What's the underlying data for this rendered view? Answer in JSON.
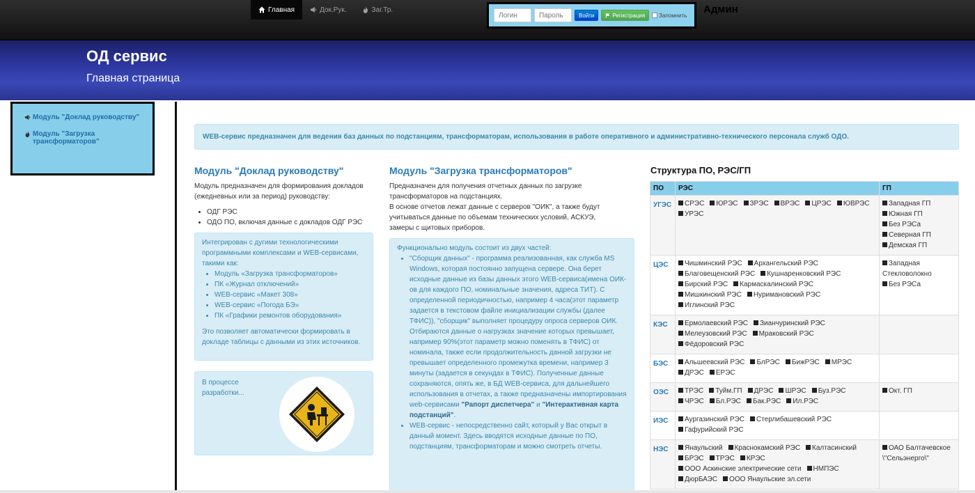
{
  "nav": {
    "items": [
      {
        "label": "Главная",
        "icon": "home-icon",
        "active": true
      },
      {
        "label": "Док.Рук.",
        "icon": "megaphone-icon",
        "active": false
      },
      {
        "label": "Заг.Тр.",
        "icon": "fire-icon",
        "active": false
      }
    ]
  },
  "login": {
    "login_placeholder": "Логин",
    "password_placeholder": "Пароль",
    "submit_label": "Войти",
    "register_label": "Регистрация",
    "remember_label": "Запомнить"
  },
  "user": {
    "name": "Админ"
  },
  "hero": {
    "title": "ОД сервис",
    "subtitle": "Главная страница"
  },
  "sidebar": {
    "items": [
      {
        "label": "Модуль \"Доклад руководству\"",
        "icon": "megaphone-icon"
      },
      {
        "label": "Модуль \"Загрузка трансформаторов\"",
        "icon": "fire-icon"
      }
    ]
  },
  "intro": "WEB-сервис предназначен для ведения баз данных по подстанциям, трансформаторам, использования в работе оперативного и административно-технического персонала служб ОДО.",
  "col1": {
    "heading": "Модуль \"Доклад руководству\"",
    "text": "Модуль предназначен для формирования докладов (ежедневных или за период) руководству:",
    "bullets": [
      "ОДГ РЭС",
      "ОДО ПО, включая данные с докладов ОДГ РЭС"
    ],
    "well_text": "Интегрирован с дугими технологическими программными комплексами и WEB-сервисами, такими как:",
    "well_bullets": [
      "Модуль «Загрузка трансформаторов»",
      "ПК «Журнал отключений»",
      "WEB-сервис «Макет 308»",
      "WEB-сервис «Погода БЭ»",
      "ПК «Графики ремонтов оборудования»"
    ],
    "well_footer": "Это позволяет автоматически формировать в докладе таблицы с данными из этих источников.",
    "dev_text": "В процессе разработки..."
  },
  "col2": {
    "heading": "Модуль \"Загрузка трансформаторов\"",
    "text1": "Предназначен для получения отчетных данных по загрузке трансформаторов на подстанциях.",
    "text2": "В основе отчетов лежат данные с серверов \"ОИК\", а также будут учитываться данные по объемам технических условий, АСКУЭ, замеры с щитовых приборов.",
    "well_intro": "Функционально модуль состоит из двух частей:",
    "bullet1": "\"Сборщик данных\" - программа реализованная, как служба MS Windows, которая постоянно запущена сервере. Она берет исходные данные из базы данных этого WEB-сервиса(имена ОИК-ов для каждого ПО, номинальные значения, адреса ТИТ). С определенной периодичностью, например 4 часа(этот параметр задается в текстовом файле инициализации службы (далее ТФИС)), \"сборщик\" выполняет процедуру опроса серверов ОИК. Отбираются данные о нагрузках значение которых превышает, например 90%(этот параметр можно поменять в ТФИС) от номинала, также если продолжительность данной загрузки не превышает определенного промежутка времени, например 3 минуты (задается в секундах в ТФИС). Полученные данные сохраняются, опять же, в БД WEB-сервиса, для дальнейшего использования в отчетах, а также предназначены импортирования web-сервисами",
    "b1_strong1": "\"Рапорт диспетчера\"",
    "b1_and": " и ",
    "b1_strong2": "\"Интерактивная карта подстанций\"",
    "b1_end": ".",
    "bullet2": "WEB-сервис - непосредственно сайт, который у Вас открыт в данный момент. Здесь вводятся исходные данные по ПО, подстанциям, трансформаторам и можно смотреть отчеты."
  },
  "structure": {
    "title": "Структура ПО, РЭС/ГП",
    "headers": [
      "ПО",
      "РЭС",
      "ГП"
    ],
    "rows": [
      {
        "po": "УГЭС",
        "res": [
          "СРЭС",
          "ЮРЭС",
          "ЗРЭС",
          "ВРЭС",
          "ЦРЭС",
          "ЮВРЭС",
          "УРЭС"
        ],
        "gp": [
          "Западная ГП",
          "Южная ГП",
          "Без РЭСа",
          "Северная ГП",
          "Демская ГП"
        ],
        "gp_bullets": true
      },
      {
        "po": "ЦЭС",
        "res": [
          "Чишминский РЭС",
          "Архангельский РЭС",
          "Благовещенский РЭС",
          "Кушнаренковский РЭС",
          "Бирский РЭС",
          "Кармаскалинский РЭС",
          "Мишкинский РЭС",
          "Нуримановский РЭС",
          "Иглинский РЭС"
        ],
        "gp": [
          "Западная Стекловолокно",
          "Без РЭСа"
        ],
        "gp_bullets": true
      },
      {
        "po": "КЭС",
        "res": [
          "Ермолаевский РЭС",
          "Зианчуринский РЭС",
          "Мелеузовский РЭС",
          "Мраковский РЭС",
          "Фёдоровский РЭС"
        ],
        "gp": [],
        "gp_bullets": true
      },
      {
        "po": "БЭС",
        "res": [
          "Альшеевский РЭС",
          "БлРЭС",
          "БижРЭС",
          "МРЭС",
          "ДРЭС",
          "ЕРЭС"
        ],
        "gp": [],
        "gp_bullets": true
      },
      {
        "po": "ОЭС",
        "res": [
          "ТРЭС",
          "Туйм.ГП",
          "ДРЭС",
          "ШРЭС",
          "Буз.РЭС",
          "ЧРЭС",
          "Бл.РЭС",
          "Бак.РЭС",
          "Ил.РЭС"
        ],
        "gp": [
          "Окт. ГП"
        ],
        "gp_bullets": true
      },
      {
        "po": "ИЭС",
        "res": [
          "Аургазинский РЭС",
          "Стерлибашевский РЭС",
          "Гафурийский РЭС"
        ],
        "gp": [],
        "gp_bullets": true
      },
      {
        "po": "НЭС",
        "res": [
          "Янаульский",
          "Краснокамский РЭС",
          "Калтасинский",
          "БРЭС",
          "ТРЭС",
          "КРЭС",
          "ООО Аскинские электрические сети",
          "НМПЭС",
          "ДюрБАЭС",
          "ООО Янаульские эл.сети"
        ],
        "gp": [
          "ОАО Балтачевское \\\"Сельэнерго\\\""
        ],
        "gp_bullets": true
      }
    ]
  }
}
